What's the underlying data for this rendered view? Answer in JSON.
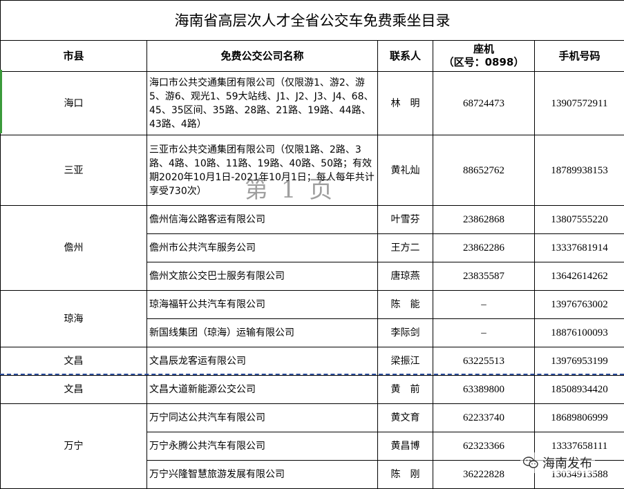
{
  "title": "海南省高层次人才全省公交车免费乘坐目录",
  "headers": {
    "county": "市县",
    "company": "免费公交公司名称",
    "contact": "联系人",
    "landline": "座机",
    "landline_area": "（区号：0898）",
    "mobile": "手机号码"
  },
  "rows": [
    {
      "county": "海口",
      "company": "海口市公共交通集团有限公司（仅限游1、游2、游5、游6、观光1、59大站线、J1、J2、J3、J4、68、45、35区间、35路、28路、21路、19路、44路、43路、4路）",
      "contact": "林　明",
      "landline": "68724473",
      "mobile": "13907572911"
    },
    {
      "county": "三亚",
      "company": "三亚市公共交通集团有限公司（仅限1路、2路、3路、4路、10路、11路、19路、40路、50路；有效期2020年10月1日-2021年10月1日；每人每年共计享受730次）",
      "contact": "黄礼灿",
      "landline": "88652762",
      "mobile": "18789938153"
    },
    {
      "county": "儋州",
      "company": "儋州信海公路客运有限公司",
      "contact": "叶雪芬",
      "landline": "23862868",
      "mobile": "13807555220"
    },
    {
      "county": "",
      "company": "儋州市公共汽车服务公司",
      "contact": "王方二",
      "landline": "23862286",
      "mobile": "13337681914"
    },
    {
      "county": "",
      "company": "儋州文旅公交巴士服务有限公司",
      "contact": "唐琼燕",
      "landline": "23835587",
      "mobile": "13642614262"
    },
    {
      "county": "琼海",
      "company": "琼海福轩公共汽车有限公司",
      "contact": "陈　能",
      "landline": "–",
      "mobile": "13976763002"
    },
    {
      "county": "",
      "company": "新国线集团（琼海）运输有限公司",
      "contact": "李际剑",
      "landline": "–",
      "mobile": "18876100093"
    },
    {
      "county": "文昌",
      "company": "文昌辰龙客运有限公司",
      "contact": "梁振江",
      "landline": "63225513",
      "mobile": "13976953199"
    },
    {
      "county": "文昌",
      "company": "文昌大道新能源公交公司",
      "contact": "黄　前",
      "landline": "63389800",
      "mobile": "18508934420"
    },
    {
      "county": "万宁",
      "company": "万宁同达公共汽车有限公司",
      "contact": "黄文育",
      "landline": "62233740",
      "mobile": "18689806999"
    },
    {
      "county": "",
      "company": "万宁永腾公共汽车有限公司",
      "contact": "黄昌博",
      "landline": "62323366",
      "mobile": "13337658111"
    },
    {
      "county": "",
      "company": "万宁兴隆智慧旅游发展有限公司",
      "contact": "陈　刚",
      "landline": "36222828",
      "mobile": "13034913588"
    }
  ],
  "watermark": "第 1 页",
  "logo": {
    "text": "海南发布",
    "icon": "wechat-icon"
  }
}
